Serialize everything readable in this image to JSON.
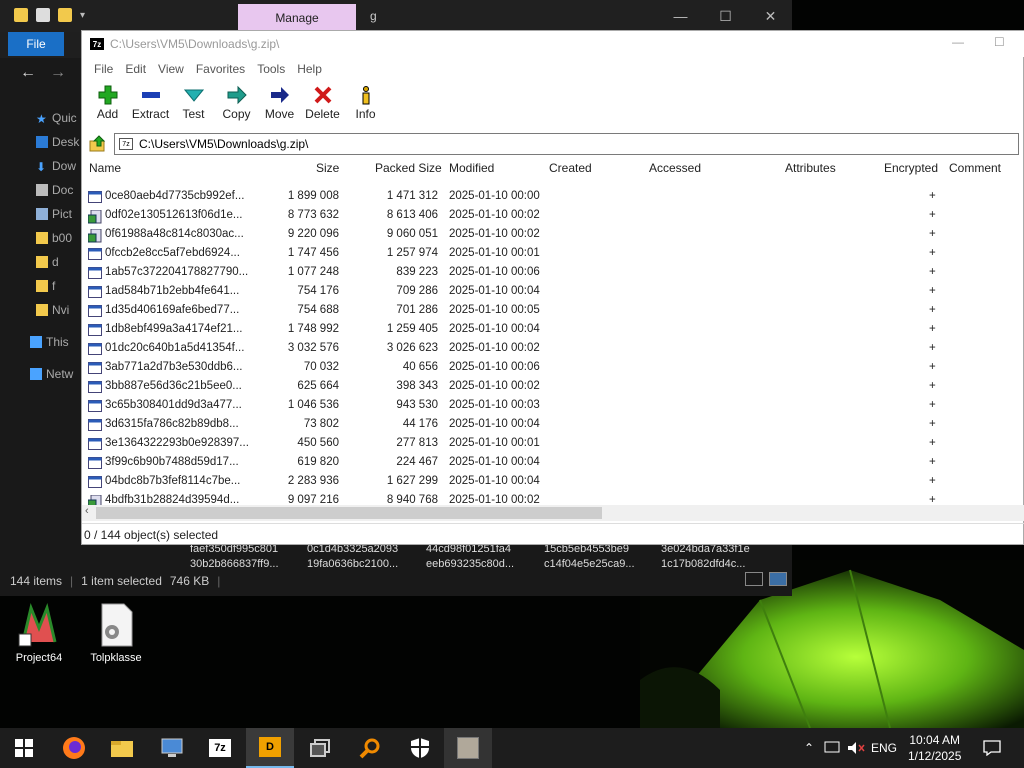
{
  "explorer": {
    "manage_tab": "Manage",
    "title": "g",
    "file_tab": "File",
    "sidebar": [
      "Quic",
      "Desk",
      "Dow",
      "Doc",
      "Pict",
      "b00",
      "d",
      "f",
      "Nvi",
      "This",
      "Netw"
    ],
    "bg_rows": [
      [
        "faef350df995c801",
        "0c1d4b3325a2093",
        "44cd98f01251fa4",
        "15cb5eb4553be9",
        "3e024bda7a33f1e"
      ],
      [
        "30b2b866837ff9...",
        "19fa0636bc2100...",
        "eeb693235c80d...",
        "c14f04e5e25ca9...",
        "1c17b082dfd4c..."
      ]
    ],
    "status_items": "144 items",
    "status_selected": "1 item selected",
    "status_size": "746 KB"
  },
  "zip": {
    "title": "C:\\Users\\VM5\\Downloads\\g.zip\\",
    "menu": [
      "File",
      "Edit",
      "View",
      "Favorites",
      "Tools",
      "Help"
    ],
    "toolbar": [
      {
        "label": "Add",
        "icon": "add-icon",
        "color": "#22a822"
      },
      {
        "label": "Extract",
        "icon": "extract-icon",
        "color": "#1b3fb5"
      },
      {
        "label": "Test",
        "icon": "test-icon",
        "color": "#23b0b0"
      },
      {
        "label": "Copy",
        "icon": "copy-icon",
        "color": "#1f9c8b"
      },
      {
        "label": "Move",
        "icon": "move-icon",
        "color": "#1a2a8a"
      },
      {
        "label": "Delete",
        "icon": "delete-icon",
        "color": "#d01a1a"
      },
      {
        "label": "Info",
        "icon": "info-icon",
        "color": "#d6a400"
      }
    ],
    "address": "C:\\Users\\VM5\\Downloads\\g.zip\\",
    "columns": [
      "Name",
      "Size",
      "Packed Size",
      "Modified",
      "Created",
      "Accessed",
      "Attributes",
      "Encrypted",
      "Comment"
    ],
    "rows": [
      {
        "name": "0ce80aeb4d7735cb992ef...",
        "size": "1 899 008",
        "packed": "1 471 312",
        "modified": "2025-01-10 00:00",
        "enc": "+",
        "icon": "exe"
      },
      {
        "name": "0df02e130512613f06d1e...",
        "size": "8 773 632",
        "packed": "8 613 406",
        "modified": "2025-01-10 00:02",
        "enc": "+",
        "icon": "setup"
      },
      {
        "name": "0f61988a48c814c8030ac...",
        "size": "9 220 096",
        "packed": "9 060 051",
        "modified": "2025-01-10 00:02",
        "enc": "+",
        "icon": "setup"
      },
      {
        "name": "0fccb2e8cc5af7ebd6924...",
        "size": "1 747 456",
        "packed": "1 257 974",
        "modified": "2025-01-10 00:01",
        "enc": "+",
        "icon": "exe"
      },
      {
        "name": "1ab57c372204178827790...",
        "size": "1 077 248",
        "packed": "839 223",
        "modified": "2025-01-10 00:06",
        "enc": "+",
        "icon": "exe"
      },
      {
        "name": "1ad584b71b2ebb4fe641...",
        "size": "754 176",
        "packed": "709 286",
        "modified": "2025-01-10 00:04",
        "enc": "+",
        "icon": "exe"
      },
      {
        "name": "1d35d406169afe6bed77...",
        "size": "754 688",
        "packed": "701 286",
        "modified": "2025-01-10 00:05",
        "enc": "+",
        "icon": "exe"
      },
      {
        "name": "1db8ebf499a3a4174ef21...",
        "size": "1 748 992",
        "packed": "1 259 405",
        "modified": "2025-01-10 00:04",
        "enc": "+",
        "icon": "exe"
      },
      {
        "name": "01dc20c640b1a5d41354f...",
        "size": "3 032 576",
        "packed": "3 026 623",
        "modified": "2025-01-10 00:02",
        "enc": "+",
        "icon": "exe"
      },
      {
        "name": "3ab771a2d7b3e530ddb6...",
        "size": "70 032",
        "packed": "40 656",
        "modified": "2025-01-10 00:06",
        "enc": "+",
        "icon": "exe"
      },
      {
        "name": "3bb887e56d36c21b5ee0...",
        "size": "625 664",
        "packed": "398 343",
        "modified": "2025-01-10 00:02",
        "enc": "+",
        "icon": "exe"
      },
      {
        "name": "3c65b308401dd9d3a477...",
        "size": "1 046 536",
        "packed": "943 530",
        "modified": "2025-01-10 00:03",
        "enc": "+",
        "icon": "exe"
      },
      {
        "name": "3d6315fa786c82b89db8...",
        "size": "73 802",
        "packed": "44 176",
        "modified": "2025-01-10 00:04",
        "enc": "+",
        "icon": "exe"
      },
      {
        "name": "3e1364322293b0e928397...",
        "size": "450 560",
        "packed": "277 813",
        "modified": "2025-01-10 00:01",
        "enc": "+",
        "icon": "exe"
      },
      {
        "name": "3f99c6b90b7488d59d17...",
        "size": "619 820",
        "packed": "224 467",
        "modified": "2025-01-10 00:04",
        "enc": "+",
        "icon": "exe"
      },
      {
        "name": "04bdc8b7b3fef8114c7be...",
        "size": "2 283 936",
        "packed": "1 627 299",
        "modified": "2025-01-10 00:04",
        "enc": "+",
        "icon": "exe"
      },
      {
        "name": "4bdfb31b28824d39594d...",
        "size": "9 097 216",
        "packed": "8 940 768",
        "modified": "2025-01-10 00:02",
        "enc": "+",
        "icon": "setup"
      }
    ],
    "status": "0 / 144 object(s) selected"
  },
  "desktop": {
    "icons": [
      {
        "label": "Project64",
        "icon": "project64-icon"
      },
      {
        "label": "Tolpklasse",
        "icon": "settings-file-icon"
      }
    ]
  },
  "taskbar": {
    "apps": [
      "start-icon",
      "firefox-icon",
      "file-explorer-icon",
      "network-monitor-icon",
      "7zip-icon",
      "dnspy-icon",
      "windows-icon",
      "search-tool-icon",
      "security-icon",
      "app-icon"
    ],
    "lang": "ENG",
    "time": "10:04 AM",
    "date": "1/12/2025"
  }
}
